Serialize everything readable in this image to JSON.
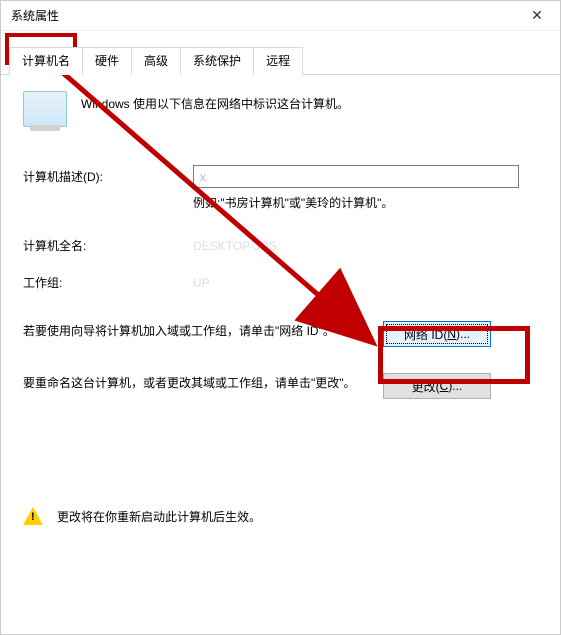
{
  "window": {
    "title": "系统属性"
  },
  "tabs": [
    {
      "label": "计算机名",
      "active": true
    },
    {
      "label": "硬件"
    },
    {
      "label": "高级"
    },
    {
      "label": "系统保护"
    },
    {
      "label": "远程"
    }
  ],
  "intro": "Windows 使用以下信息在网络中标识这台计算机。",
  "desc": {
    "label": "计算机描述(D):",
    "value": "x",
    "hint": "例如:\"书房计算机\"或\"美玲的计算机\"。"
  },
  "fullname": {
    "label": "计算机全名:",
    "value": "DESKTOP-JDS"
  },
  "workgroup": {
    "label": "工作组:",
    "value": "UP"
  },
  "networkid": {
    "text": "若要使用向导将计算机加入域或工作组，请单击\"网络 ID\"。",
    "button_prefix": "网络 ID(",
    "button_key": "N",
    "button_suffix": ")..."
  },
  "change": {
    "text": "要重命名这台计算机，或者更改其域或工作组，请单击\"更改\"。",
    "button_prefix": "更改(",
    "button_key": "C",
    "button_suffix": ")..."
  },
  "footnote": "更改将在你重新启动此计算机后生效。"
}
